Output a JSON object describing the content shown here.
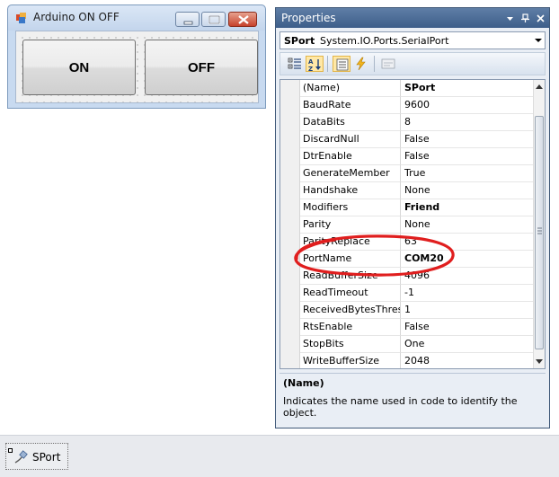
{
  "form": {
    "title": "Arduino ON OFF",
    "buttons": {
      "on_label": "ON",
      "off_label": "OFF"
    }
  },
  "properties_panel": {
    "title": "Properties",
    "object_selector": {
      "name": "SPort",
      "type": "System.IO.Ports.SerialPort"
    },
    "rows": [
      {
        "name": "(Name)",
        "value": "SPort",
        "bold": true
      },
      {
        "name": "BaudRate",
        "value": "9600",
        "bold": false
      },
      {
        "name": "DataBits",
        "value": "8",
        "bold": false
      },
      {
        "name": "DiscardNull",
        "value": "False",
        "bold": false
      },
      {
        "name": "DtrEnable",
        "value": "False",
        "bold": false
      },
      {
        "name": "GenerateMember",
        "value": "True",
        "bold": false
      },
      {
        "name": "Handshake",
        "value": "None",
        "bold": false
      },
      {
        "name": "Modifiers",
        "value": "Friend",
        "bold": true
      },
      {
        "name": "Parity",
        "value": "None",
        "bold": false
      },
      {
        "name": "ParityReplace",
        "value": "63",
        "bold": false
      },
      {
        "name": "PortName",
        "value": "COM20",
        "bold": true
      },
      {
        "name": "ReadBufferSize",
        "value": "4096",
        "bold": false
      },
      {
        "name": "ReadTimeout",
        "value": "-1",
        "bold": false
      },
      {
        "name": "ReceivedBytesThreshold",
        "value": "1",
        "bold": false
      },
      {
        "name": "RtsEnable",
        "value": "False",
        "bold": false
      },
      {
        "name": "StopBits",
        "value": "One",
        "bold": false
      },
      {
        "name": "WriteBufferSize",
        "value": "2048",
        "bold": false
      }
    ],
    "description": {
      "title": "(Name)",
      "text": "Indicates the name used in code to identify the object."
    }
  },
  "component_tray": {
    "items": [
      {
        "label": "SPort"
      }
    ]
  },
  "colors": {
    "annotation": "#e01e1e",
    "panel_title": "#4a6a96",
    "toolbar_active": "#ffe8a6"
  },
  "icons": {
    "form_app": "form-app-icon",
    "categorized": "categorized-icon",
    "alphabetical": "alphabetical-icon",
    "properties": "properties-icon",
    "events": "events-icon",
    "property_pages": "property-pages-icon",
    "tray_component": "serial-port-icon"
  }
}
